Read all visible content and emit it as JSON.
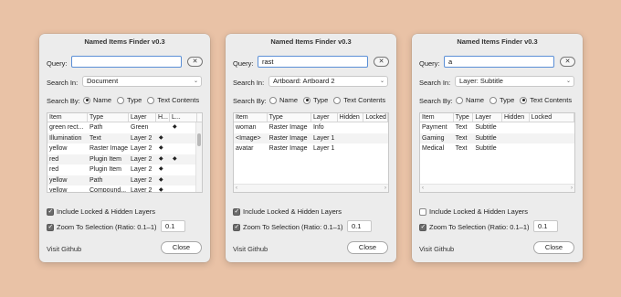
{
  "dialogs": [
    {
      "title": "Named Items Finder v0.3",
      "query_label": "Query:",
      "query_value": "",
      "clear_label": "✕",
      "search_in_label": "Search In:",
      "search_in_value": "Document",
      "search_by_label": "Search By:",
      "radio_name": "Name",
      "radio_type": "Type",
      "radio_text": "Text Contents",
      "selected_radio": "name",
      "columns": [
        "Item",
        "Type",
        "Layer",
        "H...",
        "L..."
      ],
      "rows": [
        [
          "green rect...",
          "Path",
          "Green",
          "",
          "◆"
        ],
        [
          "Illumination",
          "Text",
          "Layer 2",
          "◆",
          ""
        ],
        [
          "yellow",
          "Raster Image",
          "Layer 2",
          "◆",
          ""
        ],
        [
          "red",
          "Plugin Item",
          "Layer 2",
          "◆",
          "◆"
        ],
        [
          "red",
          "Plugin Item",
          "Layer 2",
          "◆",
          ""
        ],
        [
          "yellow",
          "Path",
          "Layer 2",
          "◆",
          ""
        ],
        [
          "yellow",
          "Compound...",
          "Layer 2",
          "◆",
          ""
        ]
      ],
      "include_locked_label": "Include Locked & Hidden Layers",
      "include_locked": true,
      "zoom_label": "Zoom To Selection (Ratio: 0.1–1)",
      "zoom_checked": true,
      "ratio_value": "0.1",
      "github_label": "Visit Github",
      "close_label": "Close"
    },
    {
      "title": "Named Items Finder v0.3",
      "query_label": "Query:",
      "query_value": "rast",
      "clear_label": "✕",
      "search_in_label": "Search In:",
      "search_in_value": "Artboard: Artboard 2",
      "search_by_label": "Search By:",
      "radio_name": "Name",
      "radio_type": "Type",
      "radio_text": "Text Contents",
      "selected_radio": "type",
      "columns": [
        "Item",
        "Type",
        "Layer",
        "Hidden",
        "Locked"
      ],
      "rows": [
        [
          "woman",
          "Raster Image",
          "Info",
          "",
          ""
        ],
        [
          "<Image>",
          "Raster Image",
          "Layer 1",
          "",
          ""
        ],
        [
          "avatar",
          "Raster Image",
          "Layer 1",
          "",
          ""
        ]
      ],
      "include_locked_label": "Include Locked & Hidden Layers",
      "include_locked": true,
      "zoom_label": "Zoom To Selection (Ratio: 0.1–1)",
      "zoom_checked": true,
      "ratio_value": "0.1",
      "github_label": "Visit Github",
      "close_label": "Close"
    },
    {
      "title": "Named Items Finder v0.3",
      "query_label": "Query:",
      "query_value": "a",
      "clear_label": "✕",
      "search_in_label": "Search In:",
      "search_in_value": "Layer: Subtitle",
      "search_by_label": "Search By:",
      "radio_name": "Name",
      "radio_type": "Type",
      "radio_text": "Text Contents",
      "selected_radio": "text",
      "columns": [
        "Item",
        "Type",
        "Layer",
        "Hidden",
        "Locked"
      ],
      "rows": [
        [
          "Payment",
          "Text",
          "Subtitle",
          "",
          ""
        ],
        [
          "Gaming",
          "Text",
          "Subtitle",
          "",
          ""
        ],
        [
          "Medical",
          "Text",
          "Subtitle",
          "",
          ""
        ]
      ],
      "include_locked_label": "Include Locked & Hidden Layers",
      "include_locked": false,
      "zoom_label": "Zoom To Selection (Ratio: 0.1–1)",
      "zoom_checked": true,
      "ratio_value": "0.1",
      "github_label": "Visit Github",
      "close_label": "Close"
    }
  ],
  "colors": {
    "background": "#e9c2a6",
    "dialog": "#ececec",
    "focus_ring": "#5b8fd6"
  },
  "icons": {
    "clear": "close-icon",
    "dropdown": "chevron-down-icon",
    "flag": "diamond-icon"
  }
}
